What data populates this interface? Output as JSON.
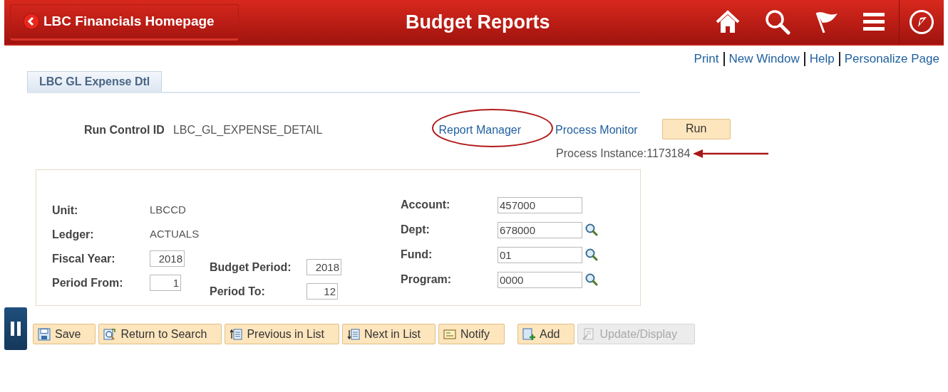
{
  "header": {
    "back_button": "LBC Financials Homepage",
    "title": "Budget Reports"
  },
  "links": [
    "Print",
    "New Window",
    "Help",
    "Personalize Page"
  ],
  "tabs": [
    {
      "label": "LBC GL Expense Dtl",
      "selected": true
    }
  ],
  "run_control": {
    "label": "Run Control ID",
    "value": "LBC_GL_EXPENSE_DETAIL"
  },
  "process_links": [
    "Report Manager",
    "Process Monitor"
  ],
  "run_button": "Run",
  "process_instance": "Process Instance:1173184",
  "form": {
    "left_column": [
      {
        "label": "Unit:",
        "kind": "text",
        "value": "LBCCD"
      },
      {
        "label": "Ledger:",
        "kind": "text",
        "value": "ACTUALS"
      },
      {
        "label": "Fiscal Year:",
        "kind": "input",
        "value": "2018"
      },
      {
        "label": "Period From:",
        "kind": "input",
        "value": "1"
      }
    ],
    "middle_column": [
      {
        "label": "Budget Period:",
        "kind": "input",
        "value": "2018"
      },
      {
        "label": "Period To:",
        "kind": "input",
        "value": "12"
      }
    ],
    "right_column": [
      {
        "label": "Account:",
        "kind": "input",
        "value": "457000",
        "lookup": false
      },
      {
        "label": "Dept:",
        "kind": "input",
        "value": "678000",
        "lookup": true
      },
      {
        "label": "Fund:",
        "kind": "input",
        "value": "01",
        "lookup": true
      },
      {
        "label": "Program:",
        "kind": "input",
        "value": "0000",
        "lookup": true
      }
    ]
  },
  "toolbar": [
    {
      "label": "Save",
      "kind": "save",
      "disabled": false
    },
    {
      "label": "Return to Search",
      "kind": "return",
      "disabled": false
    },
    {
      "label": "Previous in List",
      "kind": "previous",
      "disabled": false
    },
    {
      "label": "Next in List",
      "kind": "next",
      "disabled": false
    },
    {
      "label": "Notify",
      "kind": "notify",
      "disabled": false
    },
    {
      "label": "Add",
      "kind": "add",
      "disabled": false
    },
    {
      "label": "Update/Display",
      "kind": "update",
      "disabled": true
    }
  ]
}
